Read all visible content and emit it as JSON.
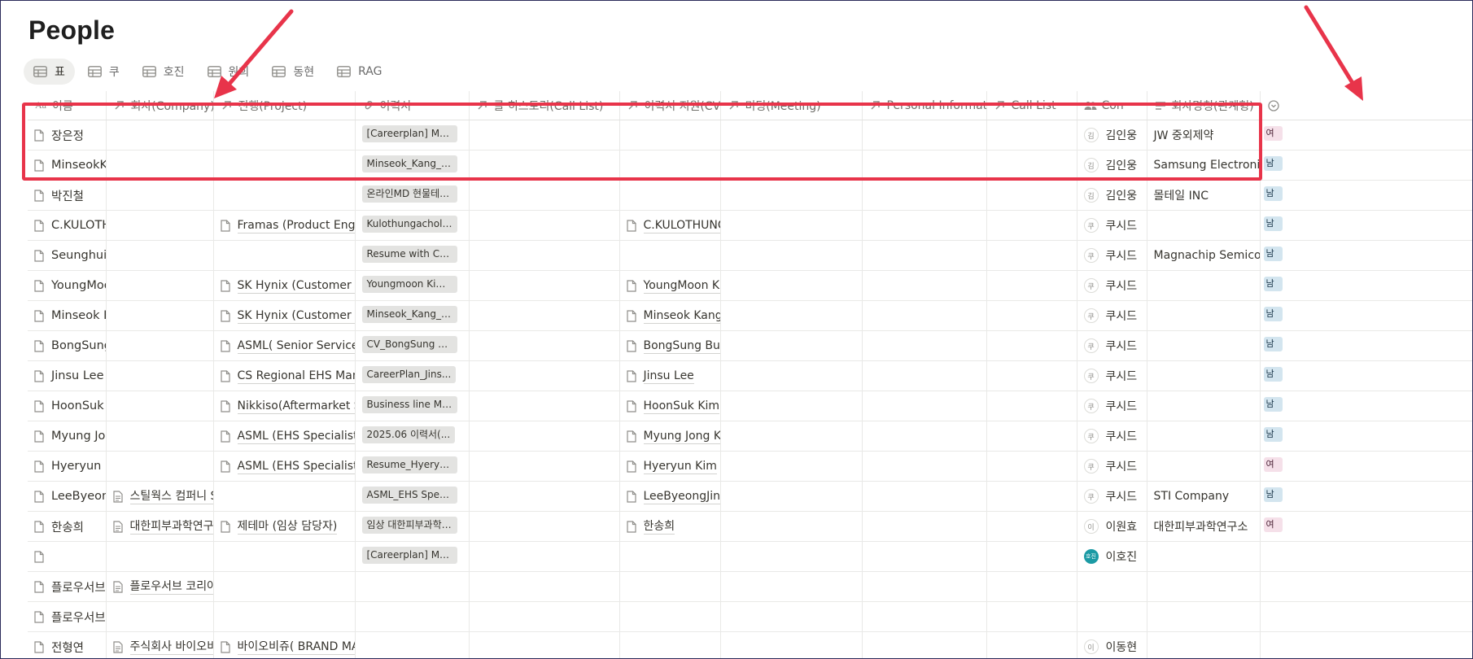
{
  "page": {
    "title": "People"
  },
  "views": [
    {
      "label": "표",
      "active": true
    },
    {
      "label": "쿠",
      "active": false
    },
    {
      "label": "호진",
      "active": false
    },
    {
      "label": "원희",
      "active": false
    },
    {
      "label": "동현",
      "active": false
    },
    {
      "label": "RAG",
      "active": false
    }
  ],
  "columns": [
    {
      "label": "이름",
      "icon": "title-icon"
    },
    {
      "label": "회사(Company)",
      "icon": "relation-icon"
    },
    {
      "label": "진행(Project)",
      "icon": "relation-icon"
    },
    {
      "label": "이력서",
      "icon": "link-icon"
    },
    {
      "label": "콜 히스토리(Call List)",
      "icon": "relation-icon"
    },
    {
      "label": "이력서 지원(CV)",
      "icon": "relation-icon"
    },
    {
      "label": "미팅(Meeting)",
      "icon": "relation-icon"
    },
    {
      "label": "Personal Information",
      "icon": "relation-icon"
    },
    {
      "label": "Call List",
      "icon": "relation-icon"
    },
    {
      "label": "Con",
      "icon": "people-icon"
    },
    {
      "label": "회사명칭(관계형)",
      "icon": "text-icon"
    },
    {
      "label": "",
      "icon": "chevron-circle-icon"
    }
  ],
  "rows": [
    {
      "name": "장은정",
      "company": "",
      "project": "",
      "resume": "[Careerplan] MS...",
      "call": "",
      "cv": "",
      "meeting": "",
      "personal": "",
      "calllist": "",
      "con_initial": "김",
      "con": "김인웅",
      "con_teal": false,
      "relname": "JW 중외제약",
      "tag": "여",
      "gender": "f"
    },
    {
      "name": "MinseokKang",
      "company": "",
      "project": "",
      "resume": "Minseok_Kang_R...",
      "call": "",
      "cv": "",
      "meeting": "",
      "personal": "",
      "calllist": "",
      "con_initial": "김",
      "con": "김인웅",
      "con_teal": false,
      "relname": "Samsung Electronics, S",
      "tag": "남",
      "gender": "m"
    },
    {
      "name": "박진철",
      "company": "",
      "project": "",
      "resume": "온라인MD 현물테일...",
      "call": "",
      "cv": "",
      "meeting": "",
      "personal": "",
      "calllist": "",
      "con_initial": "김",
      "con": "김인웅",
      "con_teal": false,
      "relname": "몰테일 INC",
      "tag": "남",
      "gender": "m"
    },
    {
      "name": "C.KULOTHUNGA",
      "company": "",
      "project": "Framas (Product Engineer",
      "resume": "Kulothungachola...",
      "call": "",
      "cv": "C.KULOTHUNGA",
      "meeting": "",
      "personal": "",
      "calllist": "",
      "con_initial": "쿠",
      "con": "쿠시드",
      "con_teal": false,
      "relname": "",
      "tag": "남",
      "gender": "m"
    },
    {
      "name": "SeunghuiChoi",
      "company": "",
      "project": "",
      "resume": "Resume with CV ...",
      "call": "",
      "cv": "",
      "meeting": "",
      "personal": "",
      "calllist": "",
      "con_initial": "쿠",
      "con": "쿠시드",
      "con_teal": false,
      "relname": "Magnachip Semiconductor",
      "tag": "남",
      "gender": "m"
    },
    {
      "name": "YoungMoon Kim",
      "company": "",
      "project": "SK Hynix (Customer Tech",
      "resume": "Youngmoon Kim...",
      "call": "",
      "cv": "YoungMoon Kim",
      "meeting": "",
      "personal": "",
      "calllist": "",
      "con_initial": "쿠",
      "con": "쿠시드",
      "con_teal": false,
      "relname": "",
      "tag": "남",
      "gender": "m"
    },
    {
      "name": "Minseok Kang",
      "company": "",
      "project": "SK Hynix (Customer Tech",
      "resume": "Minseok_Kang_R...",
      "call": "",
      "cv": "Minseok Kang",
      "meeting": "",
      "personal": "",
      "calllist": "",
      "con_initial": "쿠",
      "con": "쿠시드",
      "con_teal": false,
      "relname": "",
      "tag": "남",
      "gender": "m"
    },
    {
      "name": "BongSung Bum",
      "company": "",
      "project": "ASML( Senior Service Bus",
      "resume": "CV_BongSung B...",
      "call": "",
      "cv": "BongSung Bum",
      "meeting": "",
      "personal": "",
      "calllist": "",
      "con_initial": "쿠",
      "con": "쿠시드",
      "con_teal": false,
      "relname": "",
      "tag": "남",
      "gender": "m"
    },
    {
      "name": "Jinsu Lee",
      "company": "",
      "project": "CS Regional EHS Manage",
      "resume": "CareerPlan_Jins...",
      "call": "",
      "cv": "Jinsu Lee",
      "meeting": "",
      "personal": "",
      "calllist": "",
      "con_initial": "쿠",
      "con": "쿠시드",
      "con_teal": false,
      "relname": "",
      "tag": "남",
      "gender": "m"
    },
    {
      "name": "HoonSuk Kim",
      "company": "",
      "project": "Nikkiso(Aftermarket Serv",
      "resume": "Business line Ma...",
      "call": "",
      "cv": "HoonSuk Kim",
      "meeting": "",
      "personal": "",
      "calllist": "",
      "con_initial": "쿠",
      "con": "쿠시드",
      "con_teal": false,
      "relname": "",
      "tag": "남",
      "gender": "m"
    },
    {
      "name": "Myung Jong Kim",
      "company": "",
      "project": "ASML (EHS Specialist)",
      "resume": "2025.06 이력서(...",
      "call": "",
      "cv": "Myung Jong Kim",
      "meeting": "",
      "personal": "",
      "calllist": "",
      "con_initial": "쿠",
      "con": "쿠시드",
      "con_teal": false,
      "relname": "",
      "tag": "남",
      "gender": "m"
    },
    {
      "name": "Hyeryun Kim",
      "company": "",
      "project": "ASML (EHS Specialist)",
      "resume": "Resume_Hyeryu...",
      "call": "",
      "cv": "Hyeryun Kim",
      "meeting": "",
      "personal": "",
      "calllist": "",
      "con_initial": "쿠",
      "con": "쿠시드",
      "con_teal": false,
      "relname": "",
      "tag": "여",
      "gender": "f"
    },
    {
      "name": "LeeByeongJin",
      "company": "스틸웍스 컴퍼니 Stillw",
      "project": "",
      "resume": "ASML_EHS Spec...",
      "call": "",
      "cv": "LeeByeongJin",
      "meeting": "",
      "personal": "",
      "calllist": "",
      "con_initial": "쿠",
      "con": "쿠시드",
      "con_teal": false,
      "relname": "STI Company",
      "tag": "남",
      "gender": "m"
    },
    {
      "name": "한송희",
      "company": "대한피부과학연구소",
      "project": "제테마 (임상 담당자)",
      "resume": "임상 대한피부과학연...",
      "call": "",
      "cv": "한송희",
      "meeting": "",
      "personal": "",
      "calllist": "",
      "con_initial": "이",
      "con": "이원효",
      "con_teal": false,
      "relname": "대한피부과학연구소",
      "tag": "여",
      "gender": "f"
    },
    {
      "name": "",
      "company": "",
      "project": "",
      "resume": "[Careerplan] MS...",
      "call": "",
      "cv": "",
      "meeting": "",
      "personal": "",
      "calllist": "",
      "con_initial": "호진",
      "con": "이호진",
      "con_teal": true,
      "relname": "",
      "tag": "",
      "gender": ""
    },
    {
      "name": "플로우서브코리아",
      "company": "플로우서브 코리아",
      "project": "",
      "resume": "",
      "call": "",
      "cv": "",
      "meeting": "",
      "personal": "",
      "calllist": "",
      "con_initial": "",
      "con": "",
      "con_teal": false,
      "relname": "",
      "tag": "",
      "gender": ""
    },
    {
      "name": "플로우서브코리아",
      "company": "",
      "project": "",
      "resume": "",
      "call": "",
      "cv": "",
      "meeting": "",
      "personal": "",
      "calllist": "",
      "con_initial": "",
      "con": "",
      "con_teal": false,
      "relname": "",
      "tag": "",
      "gender": ""
    },
    {
      "name": "전형연",
      "company": "주식회사 바이오비쥬",
      "project": "바이오비쥬( BRAND MANAGER",
      "resume": "",
      "call": "",
      "cv": "",
      "meeting": "",
      "personal": "",
      "calllist": "",
      "con_initial": "이",
      "con": "이동현",
      "con_teal": false,
      "relname": "",
      "tag": "",
      "gender": ""
    }
  ],
  "colors": {
    "highlight": "#e8344a",
    "male_tag": "#d3e5ef",
    "female_tag": "#f5e0e9",
    "teal_avatar": "#1b9aa4"
  }
}
